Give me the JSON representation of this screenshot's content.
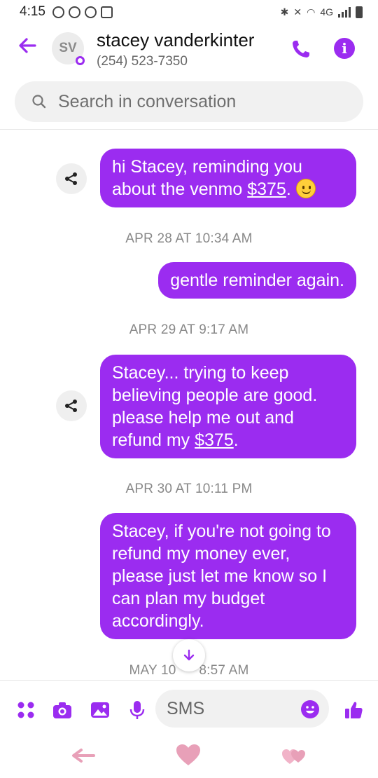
{
  "status_bar": {
    "time": "4:15",
    "network": "4G"
  },
  "header": {
    "back_icon": "arrow-left-icon",
    "avatar_initials": "SV",
    "contact_name": "stacey vanderkinter",
    "contact_phone": "(254) 523-7350",
    "call_icon": "phone-icon",
    "info_icon": "info-icon",
    "info_glyph": "i"
  },
  "search": {
    "placeholder": "Search in conversation"
  },
  "messages": [
    {
      "text_before": "hi Stacey, reminding you about the venmo ",
      "amount": "$375",
      "text_after": ". ",
      "has_emoji": true
    },
    {
      "timestamp": "APR 28 AT 10:34 AM"
    },
    {
      "text": "gentle reminder again."
    },
    {
      "timestamp": "APR 29 AT 9:17 AM"
    },
    {
      "text_before": "Stacey... trying to keep believing people are good. please help me out and refund my ",
      "amount": "$375",
      "text_after": "."
    },
    {
      "timestamp": "APR 30 AT 10:11 PM"
    },
    {
      "text": "Stacey, if you're not going to refund my money ever, please just let me know so I can plan my budget accordingly."
    },
    {
      "timestamp_left": "MAY 10",
      "timestamp_right": "8:57 AM"
    }
  ],
  "composer": {
    "placeholder": "SMS",
    "icons": [
      "apps-icon",
      "camera-icon",
      "image-icon",
      "microphone-icon",
      "emoji-icon",
      "thumbs-up-icon"
    ]
  },
  "colors": {
    "accent": "#9b2cf0",
    "bubble_text": "#ffffff",
    "timestamp": "#888888",
    "nav_pink": "#e8a0b8"
  }
}
